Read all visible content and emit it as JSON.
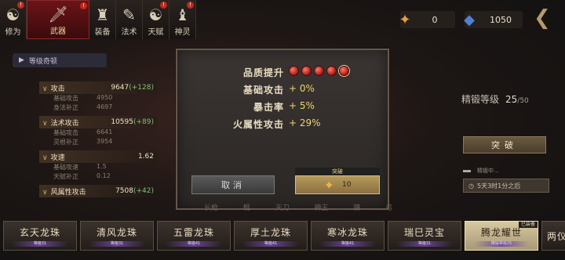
{
  "nav": {
    "tabs": [
      {
        "label": "修为",
        "icon": "cultivation-icon",
        "badge": "!"
      },
      {
        "label": "武器",
        "icon": "sword-icon",
        "badge": "!",
        "active": true
      },
      {
        "label": "装备",
        "icon": "armor-icon"
      },
      {
        "label": "法术",
        "icon": "scroll-icon"
      },
      {
        "label": "天赋",
        "icon": "yin-yang-icon",
        "badge": "!"
      },
      {
        "label": "神灵",
        "icon": "statue-icon",
        "badge": "!"
      }
    ]
  },
  "currency": [
    {
      "icon": "flame-sword-icon",
      "value": "0"
    },
    {
      "icon": "blue-crystal-icon",
      "value": "1050"
    }
  ],
  "left": {
    "level_button": "等级奇顿",
    "stats": [
      {
        "name": "攻击",
        "value": "9647",
        "bonus": "(+128)",
        "subs": [
          {
            "k": "基础攻击",
            "v": "4950"
          },
          {
            "k": "身法补正",
            "v": "4697"
          }
        ]
      },
      {
        "name": "法术攻击",
        "value": "10595",
        "bonus": "(+89)",
        "subs": [
          {
            "k": "基础攻击",
            "v": "6641"
          },
          {
            "k": "灵根补正",
            "v": "3954"
          }
        ]
      },
      {
        "name": "攻速",
        "value": "1.62",
        "bonus": "",
        "subs": [
          {
            "k": "基础攻速",
            "v": "1.5"
          },
          {
            "k": "天赋补正",
            "v": "0.12"
          }
        ]
      },
      {
        "name": "风属性攻击",
        "value": "7508",
        "bonus": "(+42)",
        "subs": []
      }
    ]
  },
  "panel": {
    "quality_label": "品质提升",
    "gem_count": 5,
    "rows": [
      {
        "k": "基础攻击",
        "v": "+ 0%"
      },
      {
        "k": "暴击率",
        "v": "+ 5%"
      },
      {
        "k": "火属性攻击",
        "v": "+ 29%"
      }
    ],
    "cancel_label": "取消",
    "break_tag": "突破",
    "break_cost": "10"
  },
  "right": {
    "refine_label": "精锻等级",
    "refine_value": "25",
    "refine_max": "/50",
    "break_button": "突破",
    "progress_label": "精锻中...",
    "timer_text": "5天3时1分之后"
  },
  "faded_tabs": [
    "长枪",
    "棍",
    "天刀",
    "神王",
    "镰",
    "弓"
  ],
  "items": [
    {
      "name": "玄天龙珠",
      "level": "等级31"
    },
    {
      "name": "清风龙珠",
      "level": "等级31"
    },
    {
      "name": "五雷龙珠",
      "level": "等级41"
    },
    {
      "name": "厚土龙珠",
      "level": "等级41"
    },
    {
      "name": "寒冰龙珠",
      "level": "等级41"
    },
    {
      "name": "瑞巳灵宝",
      "level": "等级31"
    },
    {
      "name": "腾龙耀世",
      "level": "精锻等级25",
      "equipped": "已装备",
      "selected": true
    },
    {
      "name": "两仪"
    }
  ]
}
